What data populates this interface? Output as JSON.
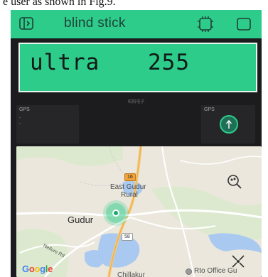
{
  "caption": {
    "text": "e user as shown in Fig.9."
  },
  "app": {
    "title": "blind stick"
  },
  "display": {
    "label": "ultra",
    "value": "255"
  },
  "brand": {
    "text": "昭阳电子"
  },
  "gps_left": {
    "label": "GPS",
    "lines": [
      "-",
      "-"
    ]
  },
  "gps_right": {
    "label": "GPS"
  },
  "map": {
    "road_16": "16",
    "road_58": "58",
    "places": {
      "east_gudur": "East Gudur",
      "rural": "Rural",
      "gudur": "Gudur",
      "chillakur": "Chillakur",
      "rto_office": "Rto Office Gu",
      "nellore_road": "Nellore Rd"
    },
    "google_logo": [
      "G",
      "o",
      "o",
      "g",
      "l",
      "e"
    ],
    "google_colors": [
      "#4285F4",
      "#EA4335",
      "#FBBC05",
      "#4285F4",
      "#34A853",
      "#EA4335"
    ]
  },
  "colors": {
    "accent": "#2ecc8b",
    "app_bg": "#1c1c1e",
    "map_bg": "#ebe7dc",
    "water": "#a9c9f0"
  },
  "icons": {
    "back": "back-square-icon",
    "device": "device-chip-icon",
    "window": "window-square-icon",
    "gps": "gps-arrow-icon",
    "location_search": "location-search-icon",
    "my_location": "my-location-crosshair-icon"
  }
}
